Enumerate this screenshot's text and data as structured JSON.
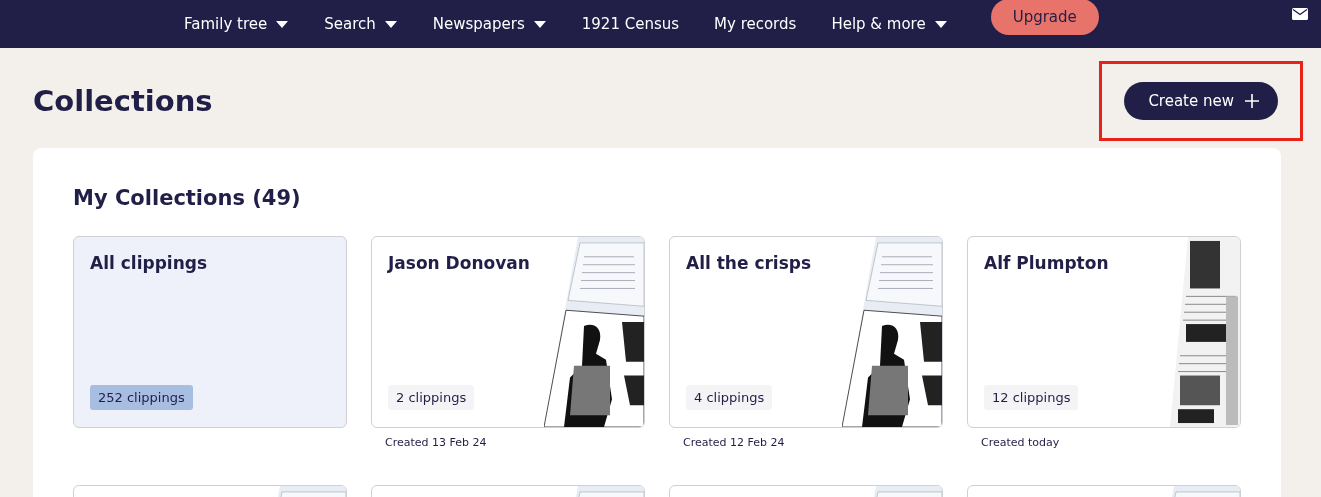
{
  "nav": {
    "items": [
      {
        "label": "Family tree",
        "dropdown": true
      },
      {
        "label": "Search",
        "dropdown": true
      },
      {
        "label": "Newspapers",
        "dropdown": true
      },
      {
        "label": "1921 Census",
        "dropdown": false
      },
      {
        "label": "My records",
        "dropdown": false
      },
      {
        "label": "Help & more",
        "dropdown": true
      }
    ],
    "upgrade": "Upgrade"
  },
  "page": {
    "title": "Collections",
    "create_button": {
      "label": "Create new",
      "highlighted": true
    }
  },
  "panel": {
    "title": "My Collections (49)",
    "collections": [
      {
        "name": "All clippings",
        "count": "252 clippings",
        "kind": "all"
      },
      {
        "name": "Jason Donovan",
        "count": "2 clippings",
        "kind": "clipping",
        "created": "Created 13 Feb 24"
      },
      {
        "name": "All the crisps",
        "count": "4 clippings",
        "kind": "clipping",
        "created": "Created 12 Feb 24"
      },
      {
        "name": "Alf Plumpton",
        "count": "12 clippings",
        "kind": "page",
        "created": "Created today"
      },
      {
        "kind": "clipping"
      },
      {
        "kind": "clipping"
      },
      {
        "kind": "clipping"
      },
      {
        "kind": "clipping"
      }
    ]
  }
}
